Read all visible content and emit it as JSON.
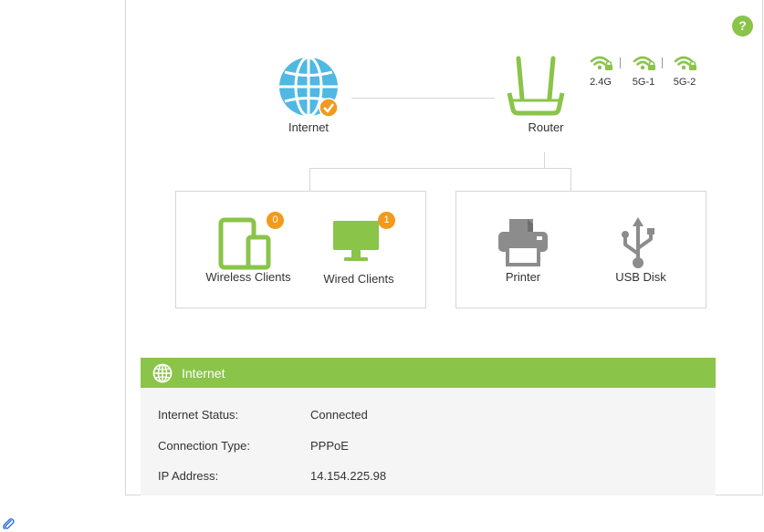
{
  "help": {
    "label": "?"
  },
  "topology": {
    "internet": {
      "label": "Internet",
      "status_icon": "check-badge-icon"
    },
    "router": {
      "label": "Router"
    },
    "bands": [
      {
        "label": "2.4G",
        "icon": "wifi-lock-icon"
      },
      {
        "label": "5G-1",
        "icon": "wifi-lock-icon"
      },
      {
        "label": "5G-2",
        "icon": "wifi-lock-icon"
      }
    ],
    "clients_group": {
      "wireless": {
        "label": "Wireless Clients",
        "count": "0"
      },
      "wired": {
        "label": "Wired Clients",
        "count": "1"
      }
    },
    "devices_group": {
      "printer": {
        "label": "Printer"
      },
      "usb": {
        "label": "USB Disk"
      }
    }
  },
  "internet_panel": {
    "title": "Internet",
    "rows": [
      {
        "key": "Internet Status:",
        "value": "Connected"
      },
      {
        "key": "Connection Type:",
        "value": "PPPoE"
      },
      {
        "key": "IP Address:",
        "value": "14.154.225.98"
      }
    ]
  },
  "colors": {
    "green": "#8ac449",
    "blue": "#4fb8e3",
    "orange": "#f29a1c",
    "gray": "#8c8c8c",
    "link_blue": "#2a6fdb"
  }
}
